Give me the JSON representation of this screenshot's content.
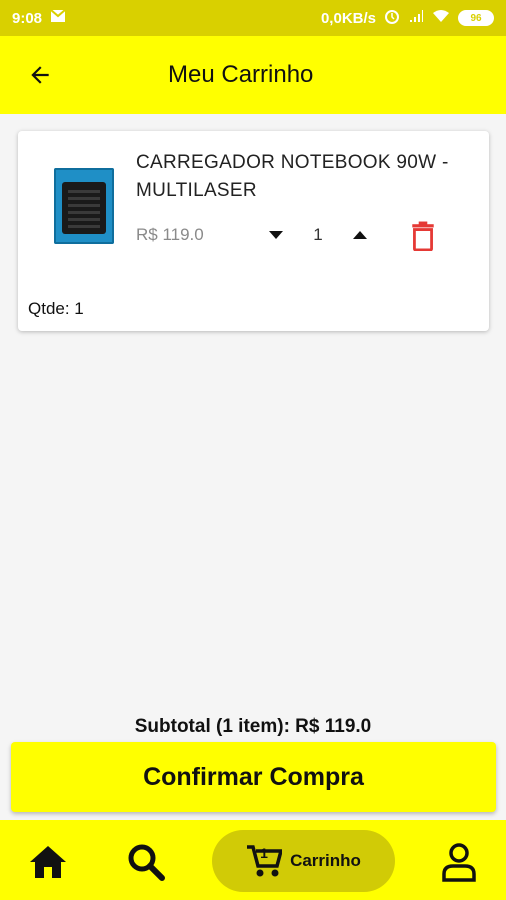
{
  "status_bar": {
    "time": "9:08",
    "network_speed": "0,0KB/s",
    "battery": "96"
  },
  "app_bar": {
    "title": "Meu Carrinho"
  },
  "cart_item": {
    "name": "CARREGADOR NOTEBOOK 90W - MULTILASER",
    "price": "R$ 119.0",
    "quantity": "1",
    "qtde_label": "Qtde: 1"
  },
  "summary": {
    "subtotal": "Subtotal (1 item): R$ 119.0"
  },
  "actions": {
    "confirm_label": "Confirmar Compra"
  },
  "bottom_nav": {
    "cart_label": "Carrinho",
    "cart_badge": "1"
  },
  "colors": {
    "accent": "#ffff00",
    "status_bar": "#d9d000",
    "active_pill": "#d1cb06",
    "delete": "#e53935"
  }
}
